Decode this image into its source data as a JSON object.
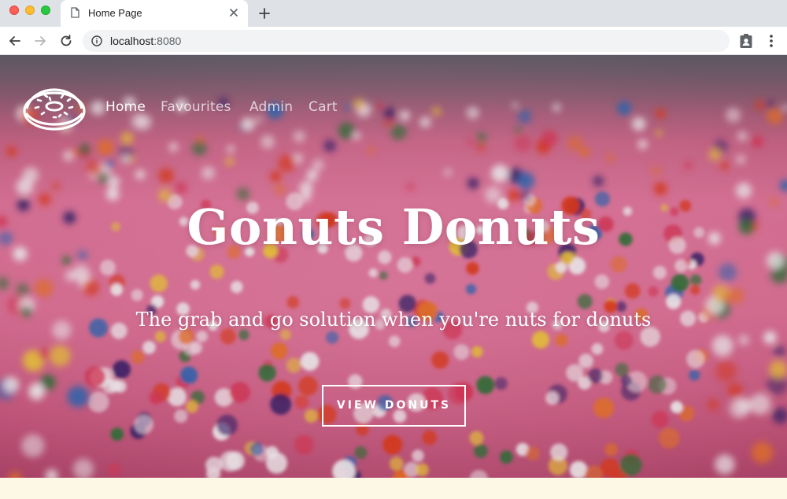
{
  "browser": {
    "tab_title": "Home Page",
    "url_host": "localhost",
    "url_port": ":8080",
    "icons": {
      "traffic_lights": [
        "close-dot",
        "minimize-dot",
        "maximize-dot"
      ],
      "tab": "page-icon",
      "tab_close": "close-icon",
      "new_tab": "plus-icon",
      "back": "back-arrow-icon",
      "forward": "forward-arrow-icon",
      "reload": "reload-icon",
      "site_info": "info-icon",
      "extension": "clipboard-user-icon",
      "menu": "kebab-menu-icon"
    }
  },
  "site": {
    "logo_icon": "donut-logo-icon",
    "nav": [
      {
        "label": "Home",
        "active": true
      },
      {
        "label": "Favourites",
        "active": false
      },
      {
        "label": "Admin",
        "active": false
      },
      {
        "label": "Cart",
        "active": false
      }
    ],
    "hero": {
      "title": "Gonuts Donuts",
      "subtitle": "The grab and go solution when you're nuts for donuts",
      "cta_label": "VIEW DONUTS"
    }
  },
  "colors": {
    "chrome_tabbar": "#dee1e6",
    "omnibox": "#f1f3f4",
    "hero_pink": "#e5779c",
    "page_cream": "#fdf8e6",
    "text_white": "#ffffff"
  }
}
